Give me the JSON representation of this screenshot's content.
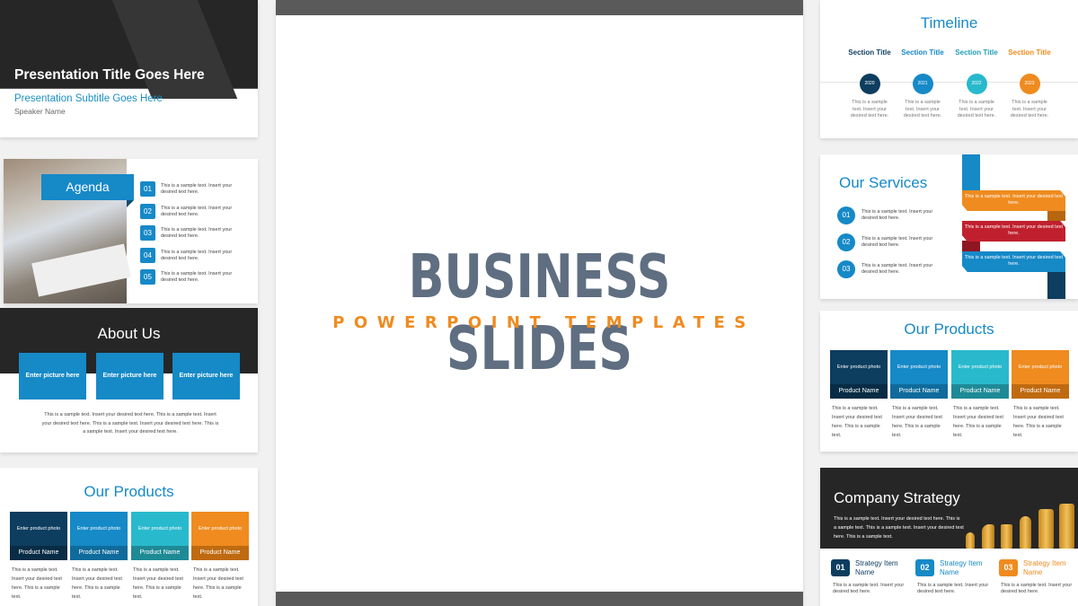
{
  "colors": {
    "navy": "#0d3d5f",
    "blue": "#1689c7",
    "teal": "#29b9cc",
    "orange": "#ef8b1f",
    "red": "#c0202e",
    "dark": "#262626",
    "hero_gray": "#5f6e80"
  },
  "hero": {
    "title": "BUSINESS SLIDES",
    "subtitle": "POWERPOINT TEMPLATES"
  },
  "title_slide": {
    "title": "Presentation Title Goes Here",
    "subtitle": "Presentation Subtitle Goes Here",
    "speaker": "Speaker Name"
  },
  "agenda": {
    "title": "Agenda",
    "items": [
      {
        "num": "01",
        "text": "This is a sample text. Insert your desired text here."
      },
      {
        "num": "02",
        "text": "This is a sample text. Insert your desired text here."
      },
      {
        "num": "03",
        "text": "This is a sample text. Insert your desired text here."
      },
      {
        "num": "04",
        "text": "This is a sample text. Insert your desired text here."
      },
      {
        "num": "05",
        "text": "This is a sample text. Insert your desired text here."
      }
    ]
  },
  "about": {
    "title": "About Us",
    "pictures": [
      "Enter picture here",
      "Enter picture here",
      "Enter picture here"
    ],
    "text": "This is a sample text. Insert your desired text here. This is a sample text. Insert your desired text here. This is a sample text. Insert your desired text here. This is a sample text. Insert your desired text here."
  },
  "products": {
    "title": "Our Products",
    "items": [
      {
        "photo": "Enter product photo",
        "name": "Product Name",
        "text": "This is a sample text. Insert your desired text here. This is a sample text."
      },
      {
        "photo": "Enter product photo",
        "name": "Product Name",
        "text": "This is a sample text. Insert your desired text here. This is a sample text."
      },
      {
        "photo": "Enter product photo",
        "name": "Product Name",
        "text": "This is a sample text. Insert your desired text here. This is a sample text."
      },
      {
        "photo": "Enter product photo",
        "name": "Product Name",
        "text": "This is a sample text. Insert your desired text here. This is a sample text."
      }
    ]
  },
  "timeline": {
    "title": "Timeline",
    "items": [
      {
        "title": "Section Title",
        "year": "2020",
        "text": "This is a sample text. Insert your desired text here."
      },
      {
        "title": "Section Title",
        "year": "2021",
        "text": "This is a sample text. Insert your desired text here."
      },
      {
        "title": "Section Title",
        "year": "2022",
        "text": "This is a sample text. Insert your desired text here."
      },
      {
        "title": "Section Title",
        "year": "2023",
        "text": "This is a sample text. Insert your desired text here."
      }
    ]
  },
  "services": {
    "title": "Our Services",
    "items": [
      {
        "num": "01",
        "text": "This is a sample text. Insert your desired text here."
      },
      {
        "num": "02",
        "text": "This is a sample text. Insert your desired text here."
      },
      {
        "num": "03",
        "text": "This is a sample text. Insert your desired text here."
      }
    ],
    "ribbons": [
      "This is a sample text. Insert your desired text here.",
      "This is a sample text. Insert your desired text here.",
      "This is a sample text. Insert your desired text here."
    ]
  },
  "strategy": {
    "title": "Company Strategy",
    "text": "This is a sample text. Insert your desired text here. This is a sample text. This is a sample text. Insert your desired text here. This is a sample text.",
    "items": [
      {
        "num": "01",
        "name": "Strategy Item Name",
        "text": "This is a sample text. Insert your desired text here."
      },
      {
        "num": "02",
        "name": "Strategy Item Name",
        "text": "This is a sample text. Insert your desired text here."
      },
      {
        "num": "03",
        "name": "Strategy Item Name",
        "text": "This is a sample text. Insert your desired text here."
      }
    ]
  }
}
